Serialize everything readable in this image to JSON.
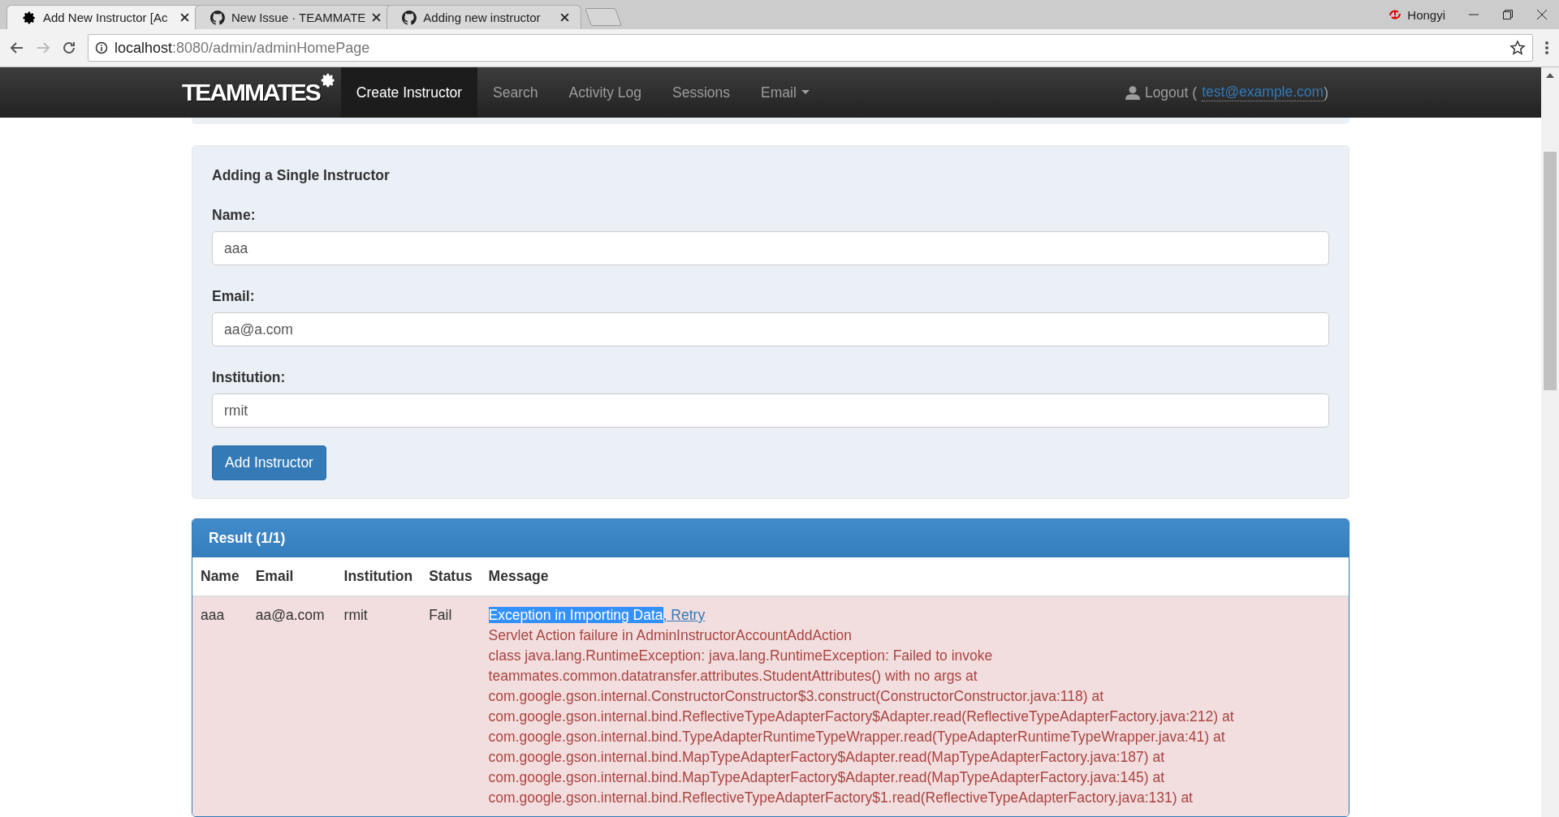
{
  "browser": {
    "tabs": [
      {
        "title": "Add New Instructor [Ac",
        "kind": "gear",
        "selected": true
      },
      {
        "title": "New Issue · TEAMMATE",
        "kind": "github",
        "selected": false
      },
      {
        "title": "Adding new instructor",
        "kind": "github",
        "selected": false
      }
    ],
    "profile": "Hongyi",
    "url_host": "localhost",
    "url_rest": ":8080/admin/adminHomePage"
  },
  "navbar": {
    "brand": "TEAMMATES",
    "items": [
      {
        "label": "Create Instructor",
        "selected": true,
        "dropdown": false
      },
      {
        "label": "Search",
        "selected": false,
        "dropdown": false
      },
      {
        "label": "Activity Log",
        "selected": false,
        "dropdown": false
      },
      {
        "label": "Sessions",
        "selected": false,
        "dropdown": false
      },
      {
        "label": "Email",
        "selected": false,
        "dropdown": true
      }
    ],
    "logout": "Logout (",
    "account": "test@example.com",
    "close_paren": ")"
  },
  "form": {
    "title": "Adding a Single Instructor",
    "fields": [
      {
        "label": "Name:",
        "value": "aaa"
      },
      {
        "label": "Email:",
        "value": "aa@a.com"
      },
      {
        "label": "Institution:",
        "value": "rmit"
      }
    ],
    "submit": "Add Instructor"
  },
  "result": {
    "title": "Result (1/1)",
    "columns": [
      "Name",
      "Email",
      "Institution",
      "Status",
      "Message"
    ],
    "rows": [
      {
        "cells": [
          "aaa",
          "aa@a.com",
          "rmit",
          "Fail"
        ],
        "message": {
          "heading": "Exception in Importing Data",
          "heading_selected": true,
          "link": ", Retry",
          "lines": [
            "Servlet Action failure in AdminInstructorAccountAddAction",
            "class java.lang.RuntimeException: java.lang.RuntimeException: Failed to invoke",
            "teammates.common.datatransfer.attributes.StudentAttributes() with no args at",
            "com.google.gson.internal.ConstructorConstructor$3.construct(ConstructorConstructor.java:118) at",
            "com.google.gson.internal.bind.ReflectiveTypeAdapterFactory$Adapter.read(ReflectiveTypeAdapterFactory.java:212) at",
            "com.google.gson.internal.bind.TypeAdapterRuntimeTypeWrapper.read(TypeAdapterRuntimeTypeWrapper.java:41) at",
            "com.google.gson.internal.bind.MapTypeAdapterFactory$Adapter.read(MapTypeAdapterFactory.java:187) at",
            "com.google.gson.internal.bind.MapTypeAdapterFactory$Adapter.read(MapTypeAdapterFactory.java:145) at",
            "com.google.gson.internal.bind.ReflectiveTypeAdapterFactory$1.read(ReflectiveTypeAdapterFactory.java:131) at"
          ]
        }
      }
    ]
  }
}
